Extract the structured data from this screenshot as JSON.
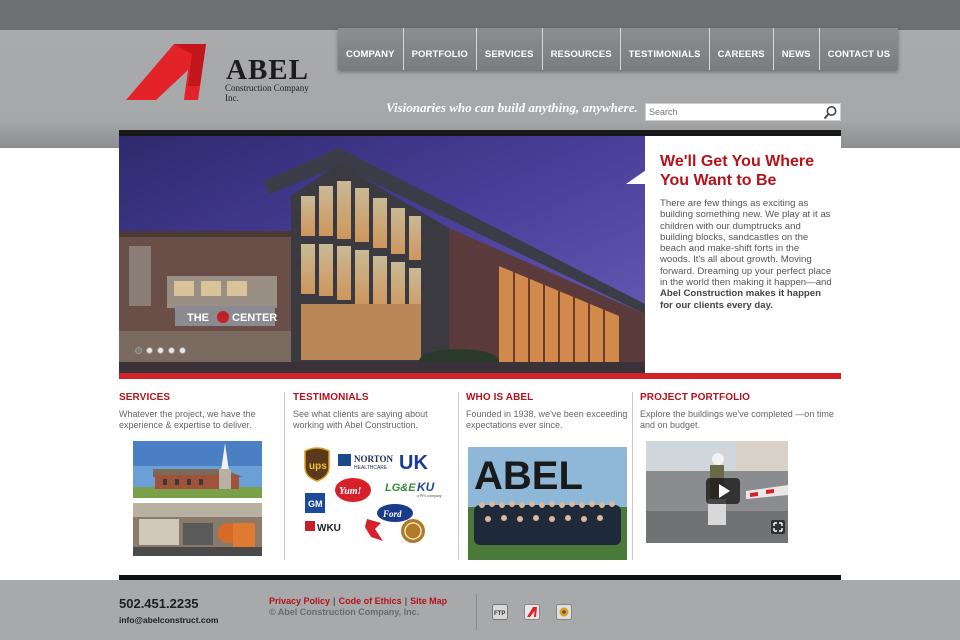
{
  "header": {
    "logo_word": "ABEL",
    "logo_sub": "Construction Company Inc.",
    "tagline": "Visionaries who can build anything, anywhere.",
    "search_placeholder": "Search"
  },
  "nav": [
    "COMPANY",
    "PORTFOLIO",
    "SERVICES",
    "RESOURCES",
    "TESTIMONIALS",
    "CAREERS",
    "NEWS",
    "CONTACT US"
  ],
  "hero": {
    "title": "We'll Get You Where You Want to Be",
    "body": "There are few things as exciting as building something new. We play at it as children with our dumptrucks and building blocks, sandcastles on the beach and make-shift forts in the woods. It's all about growth. Moving forward. Dreaming up your perfect place in the world then making it happen—and ",
    "body_bold": "Abel Construction makes it happen for our clients every day.",
    "sign_text": "THE",
    "sign_text2": "CENTER",
    "slides": 5,
    "active_slide": 1
  },
  "columns": {
    "services": {
      "title": "SERVICES",
      "text": "Whatever the project, we have the experience & expertise to deliver."
    },
    "testimonials": {
      "title": "TESTIMONIALS",
      "text": "See what clients are saying about working with Abel Construction.",
      "logos": {
        "ups": "ups",
        "norton": "NORTON",
        "norton_sub": "HEALTHCARE",
        "uk": "UK",
        "gm": "GM",
        "yum": "Yum!",
        "lge": "LG&E",
        "ku": "KU",
        "ppl": "a PPL company",
        "wku": "WKU",
        "ford": "Ford"
      }
    },
    "who": {
      "title": "WHO IS ABEL",
      "text": "Founded in 1938, we've been exceeding expectations ever since.",
      "banner": "ABEL"
    },
    "portfolio": {
      "title": "PROJECT PORTFOLIO",
      "text": "Explore the buildings we've completed —on time and on budget."
    }
  },
  "footer": {
    "phone": "502.451.2235",
    "email": "info@abelconstruct.com",
    "links": [
      "Privacy Policy",
      "Code of Ethics",
      "Site Map"
    ],
    "copyright": "© Abel Construction Company, Inc.",
    "ftp_label": "FTP"
  },
  "colors": {
    "accent": "#b5121b",
    "header": "#a6a7a9",
    "footer": "#a8a9ab"
  }
}
